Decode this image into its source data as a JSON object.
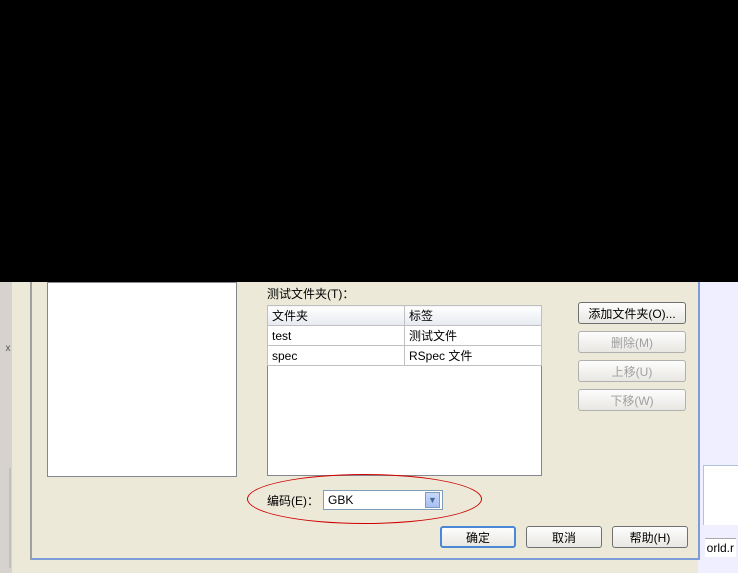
{
  "table": {
    "label": "测试文件夹(T)：",
    "headers": {
      "folder": "文件夹",
      "tag": "标签"
    },
    "rows": [
      {
        "folder": "test",
        "tag": "测试文件"
      },
      {
        "folder": "spec",
        "tag": "RSpec 文件"
      }
    ]
  },
  "buttons_right": {
    "add": "添加文件夹(O)...",
    "delete": "删除(M)",
    "up": "上移(U)",
    "down": "下移(W)"
  },
  "encoding": {
    "label": "编码(E)：",
    "value": "GBK"
  },
  "bottom": {
    "ok": "确定",
    "cancel": "取消",
    "help": "帮助(H)"
  },
  "status_fragment": "orld.r",
  "close_x": "x"
}
